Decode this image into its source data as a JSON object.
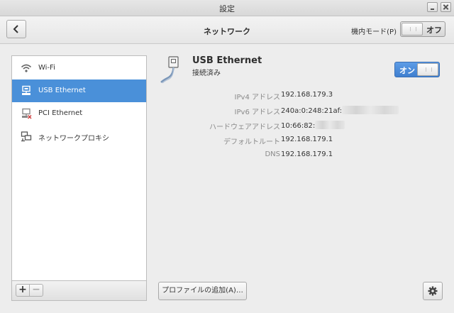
{
  "window": {
    "title": "設定"
  },
  "header": {
    "back_label": "戻る",
    "page_title": "ネットワーク",
    "airplane_mode_label": "機内モード(P)",
    "airplane_toggle_label": "オフ"
  },
  "sidebar": {
    "items": [
      {
        "label": "Wi-Fi",
        "icon": "wifi-icon"
      },
      {
        "label": "USB Ethernet",
        "icon": "wired-network-icon",
        "selected": true
      },
      {
        "label": "PCI Ethernet",
        "icon": "wired-network-disconnected-icon"
      },
      {
        "label": "ネットワークプロキシ",
        "icon": "network-proxy-icon"
      }
    ],
    "add_label": "+",
    "remove_label": "−"
  },
  "device": {
    "name": "USB Ethernet",
    "status": "接続済み",
    "toggle_label": "オン",
    "details": [
      {
        "key": "IPv4 アドレス",
        "value": "192.168.179.3"
      },
      {
        "key": "IPv6 アドレス",
        "value": "240a:0:248:21af:"
      },
      {
        "key": "ハードウェアアドレス",
        "value": "10:66:82:"
      },
      {
        "key": "デフォルトルート",
        "value": "192.168.179.1"
      },
      {
        "key": "DNS",
        "value": "192.168.179.1"
      }
    ]
  },
  "footer": {
    "add_profile_label": "プロファイルの追加(A)…"
  },
  "colors": {
    "accent": "#4a90d9"
  }
}
